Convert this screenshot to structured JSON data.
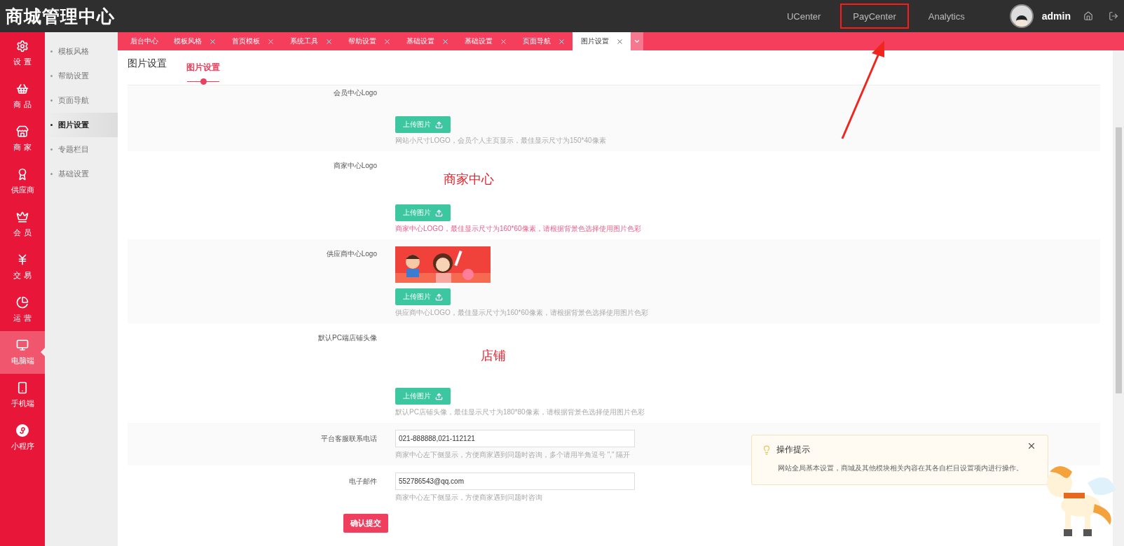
{
  "header": {
    "title": "商城管理中心",
    "links": [
      {
        "label": "UCenter",
        "highlighted": false
      },
      {
        "label": "PayCenter",
        "highlighted": true
      },
      {
        "label": "Analytics",
        "highlighted": false
      }
    ],
    "user": "admin"
  },
  "sidebar": {
    "items": [
      {
        "label": "设 置",
        "selected": false
      },
      {
        "label": "商 品",
        "selected": false
      },
      {
        "label": "商 家",
        "selected": false
      },
      {
        "label": "供应商",
        "selected": false
      },
      {
        "label": "会 员",
        "selected": false
      },
      {
        "label": "交 易",
        "selected": false
      },
      {
        "label": "运 营",
        "selected": false
      },
      {
        "label": "电脑端",
        "selected": true
      },
      {
        "label": "手机端",
        "selected": false
      },
      {
        "label": "小程序",
        "selected": false
      }
    ]
  },
  "submenu": [
    {
      "label": "模板风格",
      "selected": false
    },
    {
      "label": "帮助设置",
      "selected": false
    },
    {
      "label": "页面导航",
      "selected": false
    },
    {
      "label": "图片设置",
      "selected": true
    },
    {
      "label": "专题栏目",
      "selected": false
    },
    {
      "label": "基础设置",
      "selected": false
    }
  ],
  "tabs": [
    {
      "label": "后台中心",
      "closable": false,
      "selected": false
    },
    {
      "label": "模板风格",
      "closable": true,
      "selected": false
    },
    {
      "label": "首页模板",
      "closable": true,
      "selected": false
    },
    {
      "label": "系统工具",
      "closable": true,
      "selected": false
    },
    {
      "label": "帮助设置",
      "closable": true,
      "selected": false
    },
    {
      "label": "基础设置",
      "closable": true,
      "selected": false
    },
    {
      "label": "基础设置",
      "closable": true,
      "selected": false
    },
    {
      "label": "页面导航",
      "closable": true,
      "selected": false
    },
    {
      "label": "图片设置",
      "closable": true,
      "selected": true
    }
  ],
  "page": {
    "title": "图片设置",
    "subtabs": [
      {
        "label": "图片设置",
        "selected": true
      }
    ]
  },
  "form": [
    {
      "label": "会员中心Logo",
      "preview": {
        "kind": "blank"
      },
      "button": "上传图片",
      "hint": "网站小尺寸LOGO，会员个人主页显示，最佳显示尺寸为150*40像素",
      "emphasis": false
    },
    {
      "label": "商家中心Logo",
      "preview": {
        "kind": "text",
        "text": "商家中心"
      },
      "button": "上传图片",
      "hint": "商家中心LOGO，最佳显示尺寸为160*60像素，请根据背景色选择使用图片色彩",
      "emphasis": true
    },
    {
      "label": "供应商中心Logo",
      "button": "上传图片",
      "hint": "供应商中心LOGO，最佳显示尺寸为160*60像素，请根据背景色选择使用图片色彩",
      "emphasis": false
    },
    {
      "label": "默认PC端店铺头像",
      "preview": {
        "kind": "text",
        "text": "店铺"
      },
      "button": "上传图片",
      "hint": "默认PC店铺头像，最佳显示尺寸为180*80像素，请根据背景色选择使用图片色彩",
      "emphasis": false
    },
    {
      "kind": "text",
      "label": "平台客服联系电话",
      "value": "021-888888,021-112121",
      "hint": "商家中心左下侧显示，方便商家遇到问题时咨询，多个请用半角逗号 \",\" 隔开"
    },
    {
      "kind": "text",
      "label": "电子邮件",
      "value": "552786543@qq.com",
      "hint": "商家中心左下侧显示，方便商家遇到问题时咨询"
    }
  ],
  "submit": "确认提交",
  "tip": {
    "title": "操作提示",
    "text": "网站全局基本设置，商城及其他模块相关内容在其各自栏目设置项内进行操作。"
  }
}
